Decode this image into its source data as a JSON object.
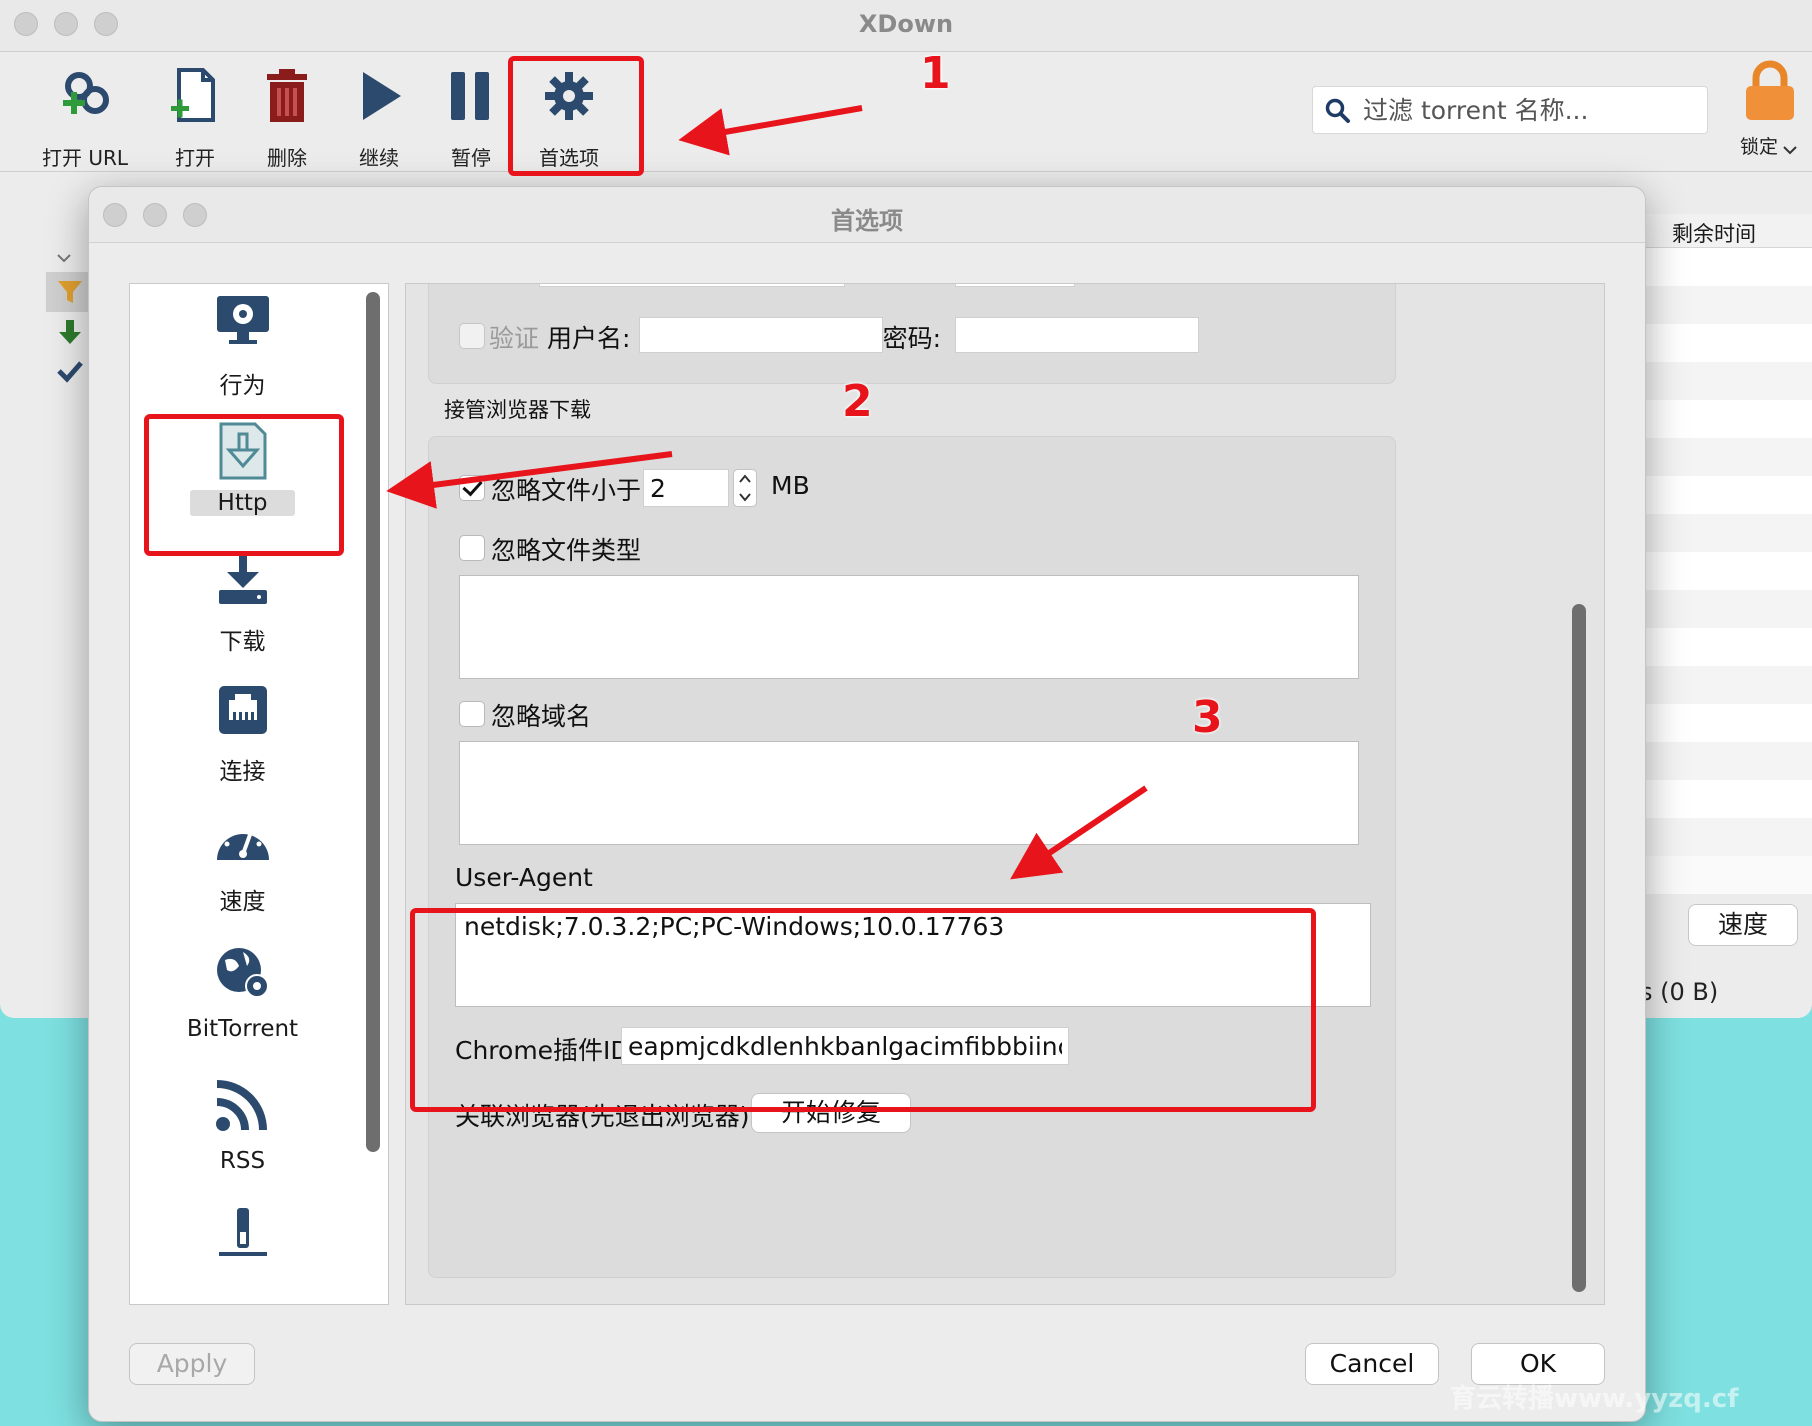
{
  "app": {
    "title": "XDown",
    "toolbar": [
      {
        "id": "open-url",
        "label": "打开 URL",
        "icon": "link-add-icon"
      },
      {
        "id": "open",
        "label": "打开",
        "icon": "file-add-icon"
      },
      {
        "id": "delete",
        "label": "删除",
        "icon": "trash-icon"
      },
      {
        "id": "resume",
        "label": "继续",
        "icon": "play-icon"
      },
      {
        "id": "pause",
        "label": "暂停",
        "icon": "pause-icon"
      },
      {
        "id": "prefs",
        "label": "首选项",
        "icon": "gear-icon"
      }
    ],
    "search_placeholder": "过滤 torrent 名称...",
    "lock_label": "锁定",
    "table_header": "剩余时间",
    "speed_button": "速度",
    "status_text": "s (0 B)"
  },
  "dialog": {
    "title": "首选项",
    "sidebar": [
      {
        "label": "行为",
        "icon": "monitor-gear-icon"
      },
      {
        "label": "Http",
        "icon": "http-download-icon",
        "selected": true
      },
      {
        "label": "下载",
        "icon": "download-tray-icon"
      },
      {
        "label": "连接",
        "icon": "ethernet-port-icon"
      },
      {
        "label": "速度",
        "icon": "speedometer-icon"
      },
      {
        "label": "BitTorrent",
        "icon": "globe-gear-icon"
      },
      {
        "label": "RSS",
        "icon": "rss-icon"
      },
      {
        "label": "",
        "icon": "plugin-icon"
      }
    ],
    "auth": {
      "verify_label": "验证",
      "username_label": "用户名:",
      "password_label": "密码:",
      "username_value": "",
      "password_value": ""
    },
    "browser_section": {
      "title": "接管浏览器下载",
      "ignore_small_label": "忽略文件小于",
      "ignore_small_checked": true,
      "ignore_small_value": "2",
      "unit": "MB",
      "ignore_types_label": "忽略文件类型",
      "ignore_types_checked": false,
      "ignore_domains_label": "忽略域名",
      "ignore_domains_checked": false,
      "user_agent_label": "User-Agent",
      "user_agent_value": "netdisk;7.0.3.2;PC;PC-Windows;10.0.17763",
      "chrome_id_label": "Chrome插件ID",
      "chrome_id_value": "eapmjcdkdlenhkbanlgacimfibbbiinc",
      "assoc_label": "关联浏览器(先退出浏览器)",
      "repair_button": "开始修复"
    },
    "buttons": {
      "apply": "Apply",
      "cancel": "Cancel",
      "ok": "OK"
    }
  },
  "annotations": {
    "steps": [
      "1",
      "2",
      "3"
    ],
    "color": "#e8141b"
  },
  "watermark": "育云转播www.yyzq.cf"
}
